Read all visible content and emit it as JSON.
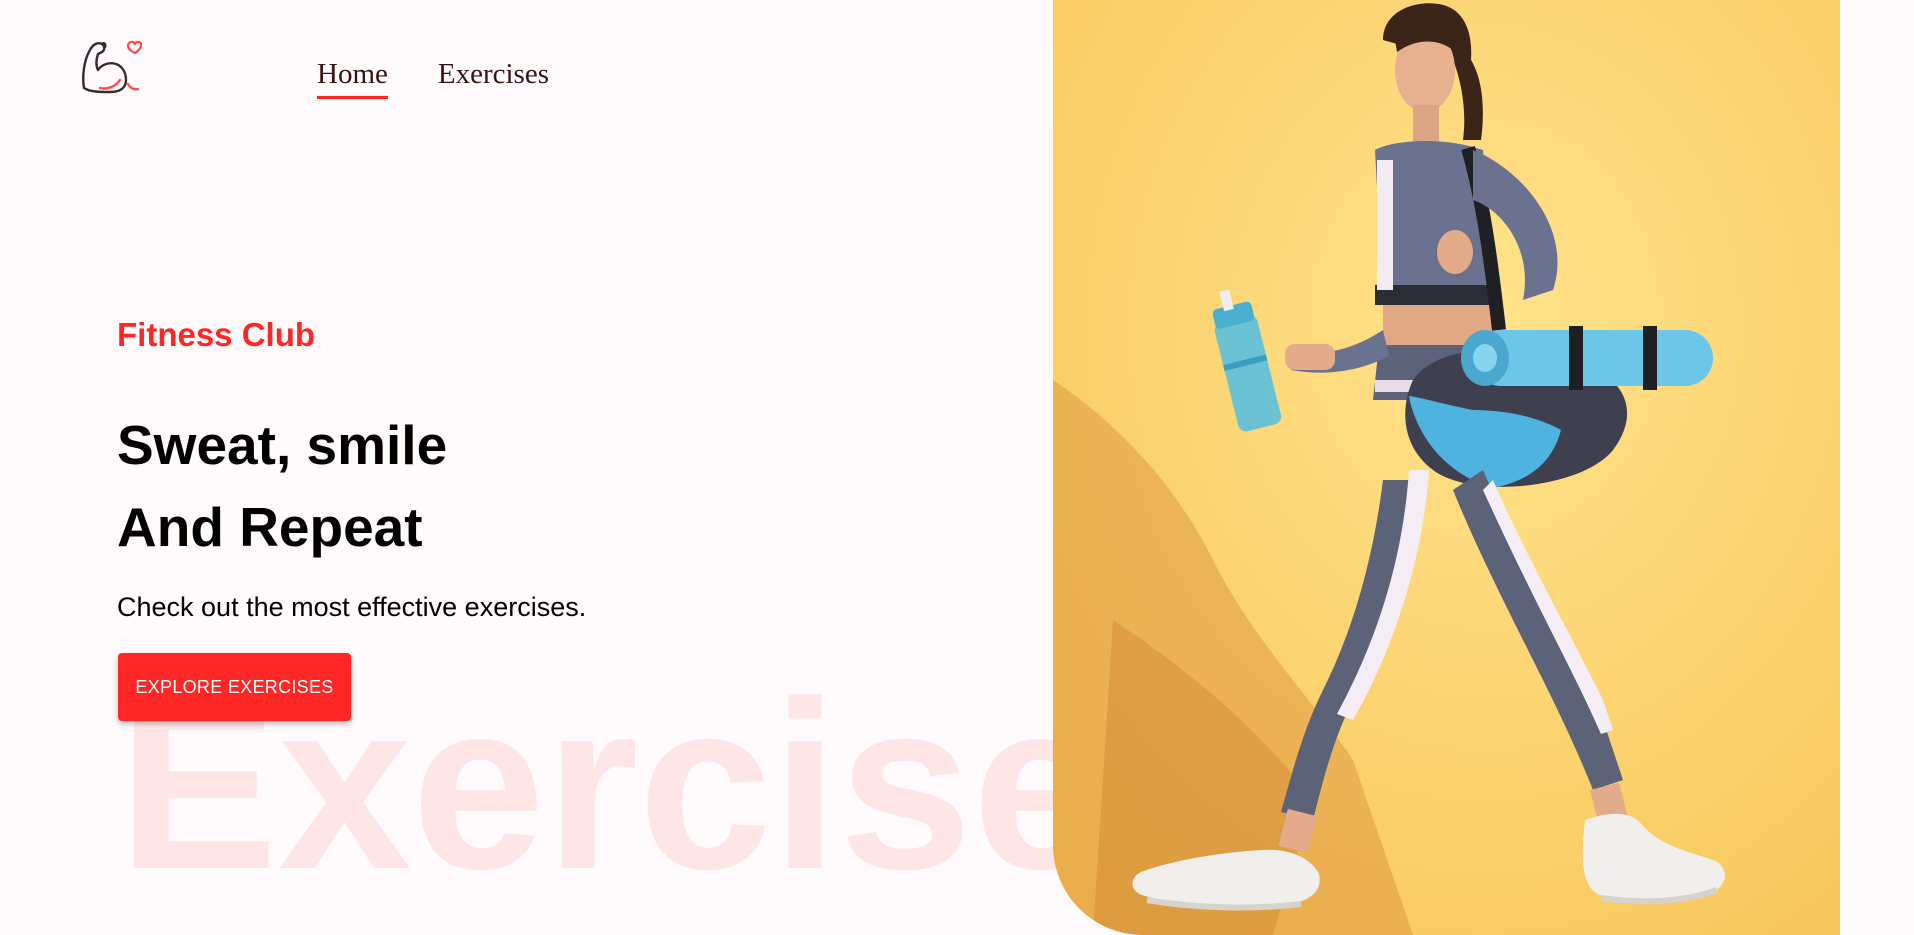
{
  "navbar": {
    "logo_icon": "flexed-arm-heart-icon",
    "links": [
      {
        "label": "Home",
        "active": true
      },
      {
        "label": "Exercises",
        "active": false
      }
    ]
  },
  "hero": {
    "kicker": "Fitness Club",
    "title_line1": "Sweat, smile",
    "title_line2": "And Repeat",
    "subtitle": "Check out the most effective exercises.",
    "button_label": "EXPLORE EXERCISES",
    "watermark": "Exercise",
    "banner_image": "woman-walking-with-gym-bag-and-shaker"
  },
  "colors": {
    "accent": "#ff2625",
    "background": "#fffafb",
    "banner_background": "#fbd476"
  }
}
